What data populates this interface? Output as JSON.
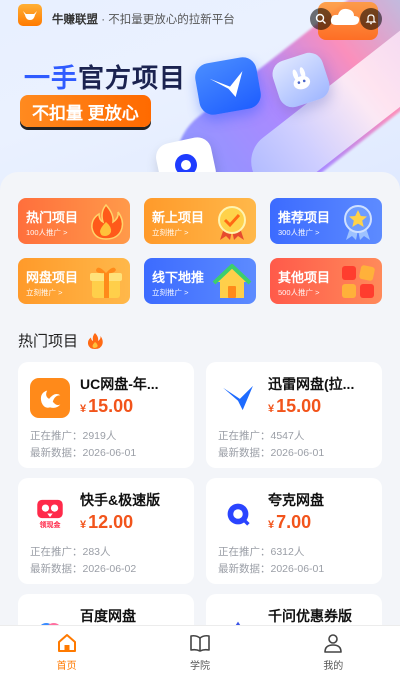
{
  "header": {
    "brand": "牛赚联盟",
    "separator": " · ",
    "tagline": "不扣量更放心的拉新平台",
    "logo_caption": "牛赚联盟",
    "search_icon": "search-icon",
    "bell_icon": "bell-icon"
  },
  "banner": {
    "headline_part1": "一手",
    "headline_part2": "官方项目",
    "slogan": "不扣量 更放心"
  },
  "categories": [
    {
      "name": "热门项目",
      "sub": "100人推广 >",
      "color": "#ff6f3c",
      "icon": "fire-icon"
    },
    {
      "name": "新上项目",
      "sub": "立刻推广 >",
      "color": "#ff9a2a",
      "icon": "medal-icon"
    },
    {
      "name": "推荐项目",
      "sub": "300人推广 >",
      "color": "#3c6bff",
      "icon": "star-badge-icon"
    },
    {
      "name": "网盘项目",
      "sub": "立刻推广 >",
      "color": "#ff9a2a",
      "icon": "gift-icon"
    },
    {
      "name": "线下地推",
      "sub": "立刻推广 >",
      "color": "#3c6bff",
      "icon": "house-icon"
    },
    {
      "name": "其他项目",
      "sub": "500人推广 >",
      "color": "#ff5a4a",
      "icon": "grid-apps-icon"
    }
  ],
  "section": {
    "title": "热门项目"
  },
  "labels": {
    "promoting": "正在推广：",
    "latest": "最新数据："
  },
  "projects": [
    {
      "name": "UC网盘-年...",
      "currency": "¥",
      "price": "15.00",
      "promoting": "2919人",
      "latest": "2026-06-01",
      "icon": "uc-icon"
    },
    {
      "name": "迅雷网盘(拉...",
      "currency": "¥",
      "price": "15.00",
      "promoting": "4547人",
      "latest": "2026-06-01",
      "icon": "xunlei-bird-icon"
    },
    {
      "name": "快手&极速版",
      "currency": "¥",
      "price": "12.00",
      "promoting": "283人",
      "latest": "2026-06-02",
      "icon": "kuaishou-icon",
      "icon_caption": "领现金"
    },
    {
      "name": "夸克网盘",
      "currency": "¥",
      "price": "7.00",
      "promoting": "6312人",
      "latest": "2026-06-01",
      "icon": "quark-icon"
    },
    {
      "name": "百度网盘",
      "icon": "baidu-netdisk-icon"
    },
    {
      "name": "千问优惠券版",
      "icon": "qianwen-icon"
    }
  ],
  "tabs": [
    {
      "label": "首页",
      "icon": "home-icon",
      "active": true
    },
    {
      "label": "学院",
      "icon": "book-icon",
      "active": false
    },
    {
      "label": "我的",
      "icon": "user-icon",
      "active": false
    }
  ],
  "colors": {
    "accent": "#ff7a00",
    "price": "#f2541b",
    "blue": "#2f5bff"
  }
}
